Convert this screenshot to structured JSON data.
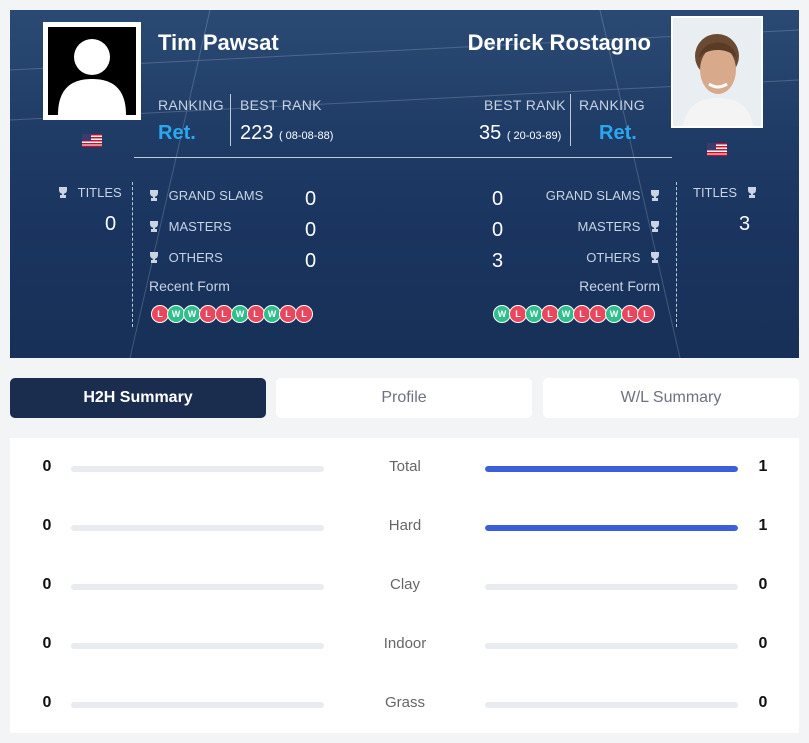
{
  "player_left": {
    "name": "Tim Pawsat",
    "ranking_label": "RANKING",
    "ranking": "Ret.",
    "best_rank_label": "BEST RANK",
    "best_rank": "223",
    "best_rank_date": "( 08-08-88)",
    "titles_label": "TITLES",
    "titles": "0",
    "grand_slams_label": "GRAND SLAMS",
    "grand_slams": "0",
    "masters_label": "MASTERS",
    "masters": "0",
    "others_label": "OTHERS",
    "others": "0",
    "recent_form_label": "Recent Form",
    "recent_form": [
      "L",
      "W",
      "W",
      "L",
      "L",
      "W",
      "L",
      "W",
      "L",
      "L"
    ]
  },
  "player_right": {
    "name": "Derrick Rostagno",
    "ranking_label": "RANKING",
    "ranking": "Ret.",
    "best_rank_label": "BEST RANK",
    "best_rank": "35",
    "best_rank_date": "( 20-03-89)",
    "titles_label": "TITLES",
    "titles": "3",
    "grand_slams_label": "GRAND SLAMS",
    "grand_slams": "0",
    "masters_label": "MASTERS",
    "masters": "0",
    "others_label": "OTHERS",
    "others": "3",
    "recent_form_label": "Recent Form",
    "recent_form": [
      "W",
      "L",
      "W",
      "L",
      "W",
      "L",
      "L",
      "W",
      "L",
      "L"
    ]
  },
  "tabs": [
    {
      "label": "H2H Summary",
      "active": true
    },
    {
      "label": "Profile",
      "active": false
    },
    {
      "label": "W/L Summary",
      "active": false
    }
  ],
  "h2h": [
    {
      "label": "Total",
      "left": 0,
      "right": 1
    },
    {
      "label": "Hard",
      "left": 0,
      "right": 1
    },
    {
      "label": "Clay",
      "left": 0,
      "right": 0
    },
    {
      "label": "Indoor",
      "left": 0,
      "right": 0
    },
    {
      "label": "Grass",
      "left": 0,
      "right": 0
    }
  ],
  "colors": {
    "win": "#2fbf8a",
    "loss": "#e8475d",
    "accent": "#29a8ee",
    "bar": "#3a5fd9",
    "tab_active": "#1b2d4f"
  }
}
